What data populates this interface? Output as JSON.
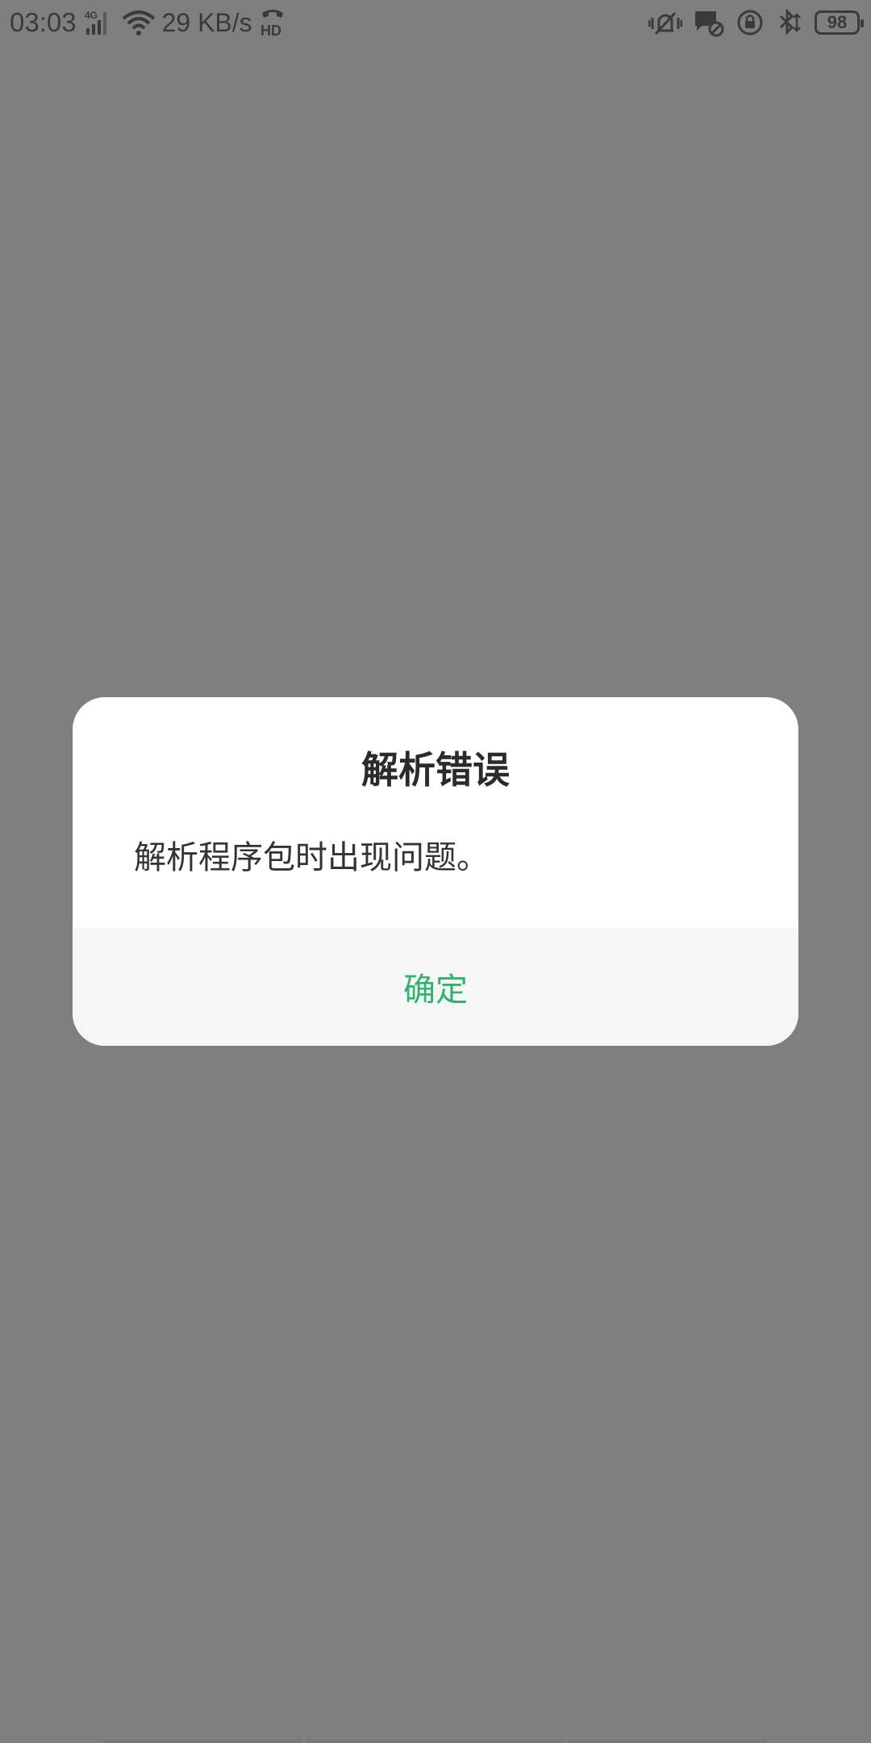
{
  "status_bar": {
    "time": "03:03",
    "network_type": "4G",
    "net_speed": "29 KB/s",
    "hd_label": "HD",
    "battery_level": "98",
    "icons": [
      "signal-icon",
      "wifi-icon",
      "hd-voice-icon",
      "vibrate-icon",
      "message-blocked-icon",
      "rotation-lock-icon",
      "bluetooth-icon",
      "battery-icon"
    ]
  },
  "dialog": {
    "title": "解析错误",
    "message": "解析程序包时出现问题。",
    "confirm_label": "确定",
    "accent_color": "#2fb36b"
  },
  "colors": {
    "scrim": "#7f7f7f",
    "dialog_bg": "#ffffff",
    "footer_bg": "#f6f6f6"
  }
}
